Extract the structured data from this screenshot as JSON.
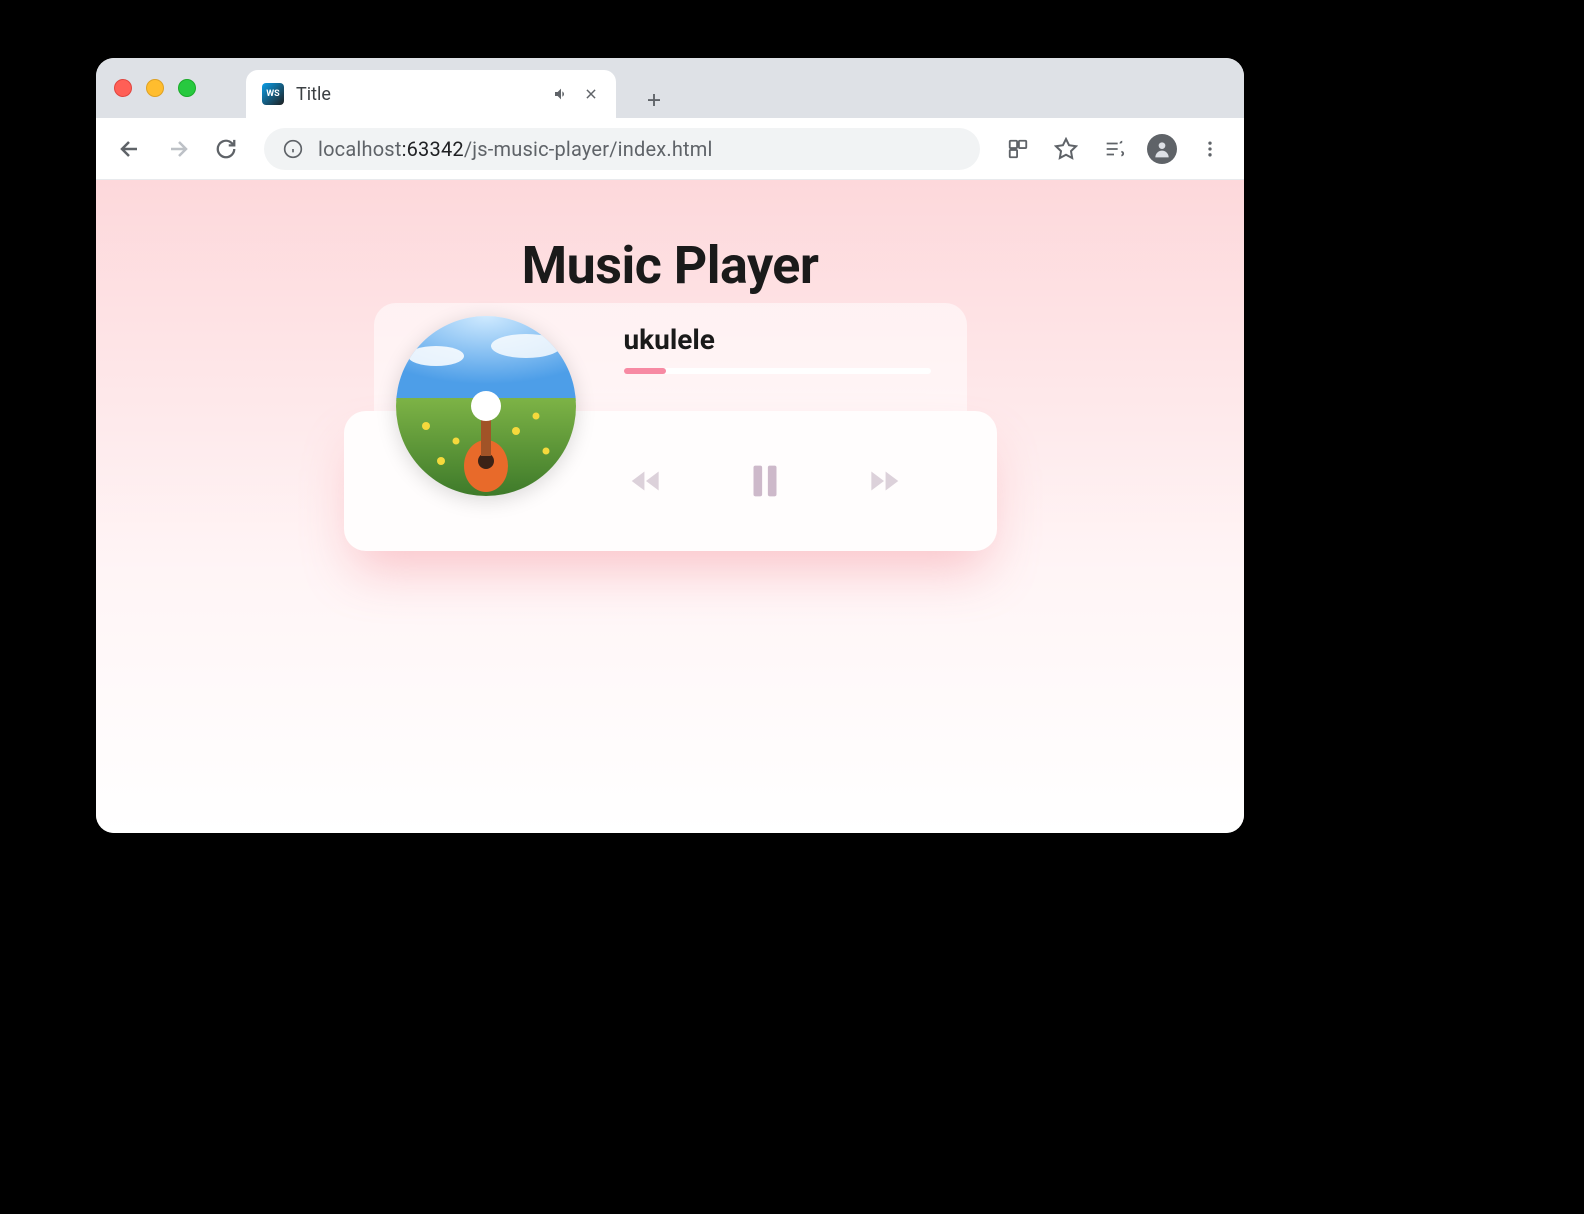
{
  "browser": {
    "tab_title": "Title",
    "url_host": "localhost",
    "url_port": ":63342",
    "url_path": "/js-music-player/index.html"
  },
  "page": {
    "heading": "Music Player"
  },
  "player": {
    "song_title": "ukulele",
    "progress_percent": 14
  }
}
